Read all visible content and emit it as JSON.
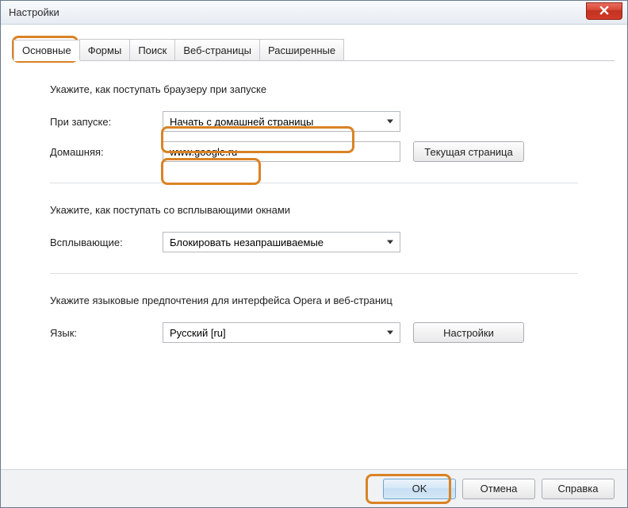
{
  "window": {
    "title": "Настройки"
  },
  "tabs": [
    {
      "label": "Основные"
    },
    {
      "label": "Формы"
    },
    {
      "label": "Поиск"
    },
    {
      "label": "Веб-страницы"
    },
    {
      "label": "Расширенные"
    }
  ],
  "startup": {
    "heading": "Укажите, как поступать браузеру при запуске",
    "on_start_label": "При запуске:",
    "on_start_value": "Начать с домашней страницы",
    "home_label": "Домашняя:",
    "home_value": "www.google.ru",
    "current_page_btn": "Текущая страница"
  },
  "popups": {
    "heading": "Укажите, как поступать со всплывающими окнами",
    "label": "Всплывающие:",
    "value": "Блокировать незапрашиваемые"
  },
  "language": {
    "heading": "Укажите языковые предпочтения для интерфейса Opera и веб-страниц",
    "label": "Язык:",
    "value": "Русский [ru]",
    "settings_btn": "Настройки"
  },
  "buttons": {
    "ok": "OK",
    "cancel": "Отмена",
    "help": "Справка"
  }
}
